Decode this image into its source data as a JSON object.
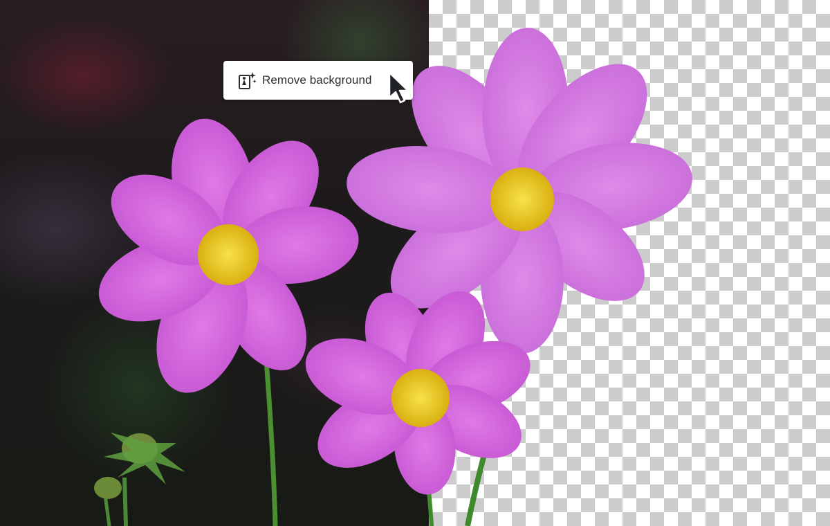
{
  "action_button": {
    "label": "Remove background",
    "icon": "remove-background-icon"
  },
  "pointer": {
    "icon": "cursor-arrow-icon"
  },
  "colors": {
    "petal": "#cf52d9",
    "petal_dark": "#a832b8",
    "center": "#f2d21b",
    "stem": "#3f8a2e",
    "checker": "#cccccc"
  }
}
